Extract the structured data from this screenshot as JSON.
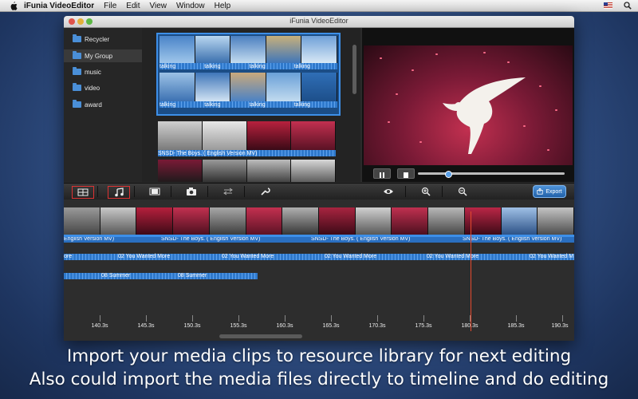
{
  "menubar": {
    "app_name": "iFunia VideoEditor",
    "items": [
      "File",
      "Edit",
      "View",
      "Window",
      "Help"
    ]
  },
  "window": {
    "title": "iFunia VideoEditor"
  },
  "sidebar": {
    "items": [
      {
        "label": "Recycler",
        "selected": false
      },
      {
        "label": "My Group",
        "selected": true
      },
      {
        "label": "music",
        "selected": false
      },
      {
        "label": "video",
        "selected": false
      },
      {
        "label": "award",
        "selected": false
      }
    ]
  },
  "library": {
    "group_rows": [
      {
        "caption": "talking"
      },
      {
        "caption": "talking"
      }
    ],
    "clips": [
      {
        "caption": "SNSD- The Boys. ( English Version MV)"
      }
    ]
  },
  "toolbar": {
    "icons": [
      "storyboard-icon",
      "music-note-icon",
      "film-icon",
      "camera-icon",
      "transition-icon",
      "wrench-icon",
      "eye-icon",
      "zoom-in-icon",
      "zoom-out-icon"
    ],
    "export_label": "Export"
  },
  "timeline": {
    "video_labels": [
      "English Version MV)",
      "SNSD- The Boys. ( English Version MV)",
      "SNSD- The Boys. ( English Version MV)",
      "SNSD- The Boys. ( English Version MV)"
    ],
    "audio_track_1": [
      "ore",
      "02 You Wanted More",
      "02 You Wanted More",
      "02 You Wanted More",
      "02 You Wanted More",
      "02 You Wanted M"
    ],
    "audio_track_2": [
      "08 Summer",
      "08 Summer"
    ],
    "ruler_labels": [
      "140.3s",
      "145.3s",
      "150.3s",
      "155.3s",
      "160.3s",
      "165.3s",
      "170.3s",
      "175.3s",
      "180.3s",
      "185.3s",
      "190.3s"
    ]
  },
  "captions": {
    "line1": "Import your media clips to resource library for next editing",
    "line2": "Also could import the media files directly to timeline and do editing"
  },
  "colors": {
    "accent_blue": "#3d8fe8",
    "playhead": "#e64a2e",
    "highlight_box": "#dd3333"
  }
}
